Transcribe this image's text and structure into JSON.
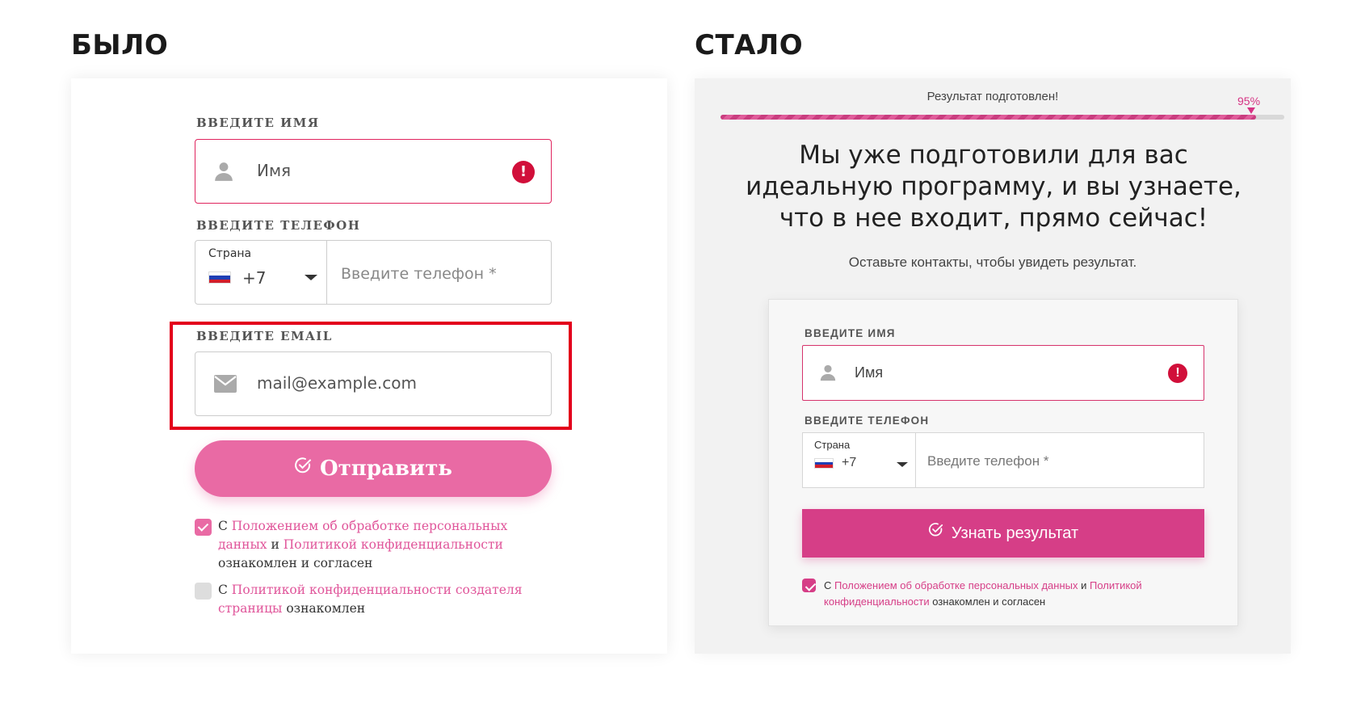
{
  "headings": {
    "before": "БЫЛО",
    "after": "СТАЛО"
  },
  "before": {
    "name_label": "ВВЕДИТЕ ИМЯ",
    "name_placeholder": "Имя",
    "name_icon": "user-icon",
    "error_icon_glyph": "!",
    "phone_label": "ВВЕДИТЕ ТЕЛЕФОН",
    "country_label": "Страна",
    "country_code": "+7",
    "phone_placeholder": "Введите телефон *",
    "email_label": "ВВЕДИТЕ EMAIL",
    "email_placeholder": "mail@example.com",
    "email_icon": "mail-icon",
    "submit_label": "Отправить",
    "consent1": {
      "prefix": "С ",
      "link1": "Положением об обработке персональных данных",
      "mid": " и ",
      "link2": "Политикой конфиденциальности",
      "suffix": " ознакомлен и согласен",
      "checked": true
    },
    "consent2": {
      "prefix": "С ",
      "link1": "Политикой конфиденциальности создателя страницы",
      "suffix": " ознакомлен",
      "checked": false
    }
  },
  "after": {
    "progress_title": "Результат подготовлен!",
    "progress_percent_label": "95%",
    "progress_value": 0.95,
    "headline": "Мы уже подготовили для вас идеальную программу, и вы узнаете, что в нее входит, прямо сейчас!",
    "subtitle": "Оставьте контакты, чтобы увидеть результат.",
    "name_label": "ВВЕДИТЕ ИМЯ",
    "name_placeholder": "Имя",
    "error_icon_glyph": "!",
    "phone_label": "ВВЕДИТЕ ТЕЛЕФОН",
    "country_label": "Страна",
    "country_code": "+7",
    "phone_placeholder": "Введите телефон *",
    "submit_label": "Узнать результат",
    "consent": {
      "prefix": "С ",
      "link1": "Положением об обработке персональных данных",
      "mid": " и ",
      "link2": "Политикой конфиденциальности",
      "suffix": " ознакомлен и согласен",
      "checked": true
    }
  },
  "colors": {
    "pink_button": "#e96aa4",
    "magenta_button": "#d63e87",
    "error": "#d10f3a",
    "highlight_border": "#e3001b",
    "link": "#e0559a"
  }
}
